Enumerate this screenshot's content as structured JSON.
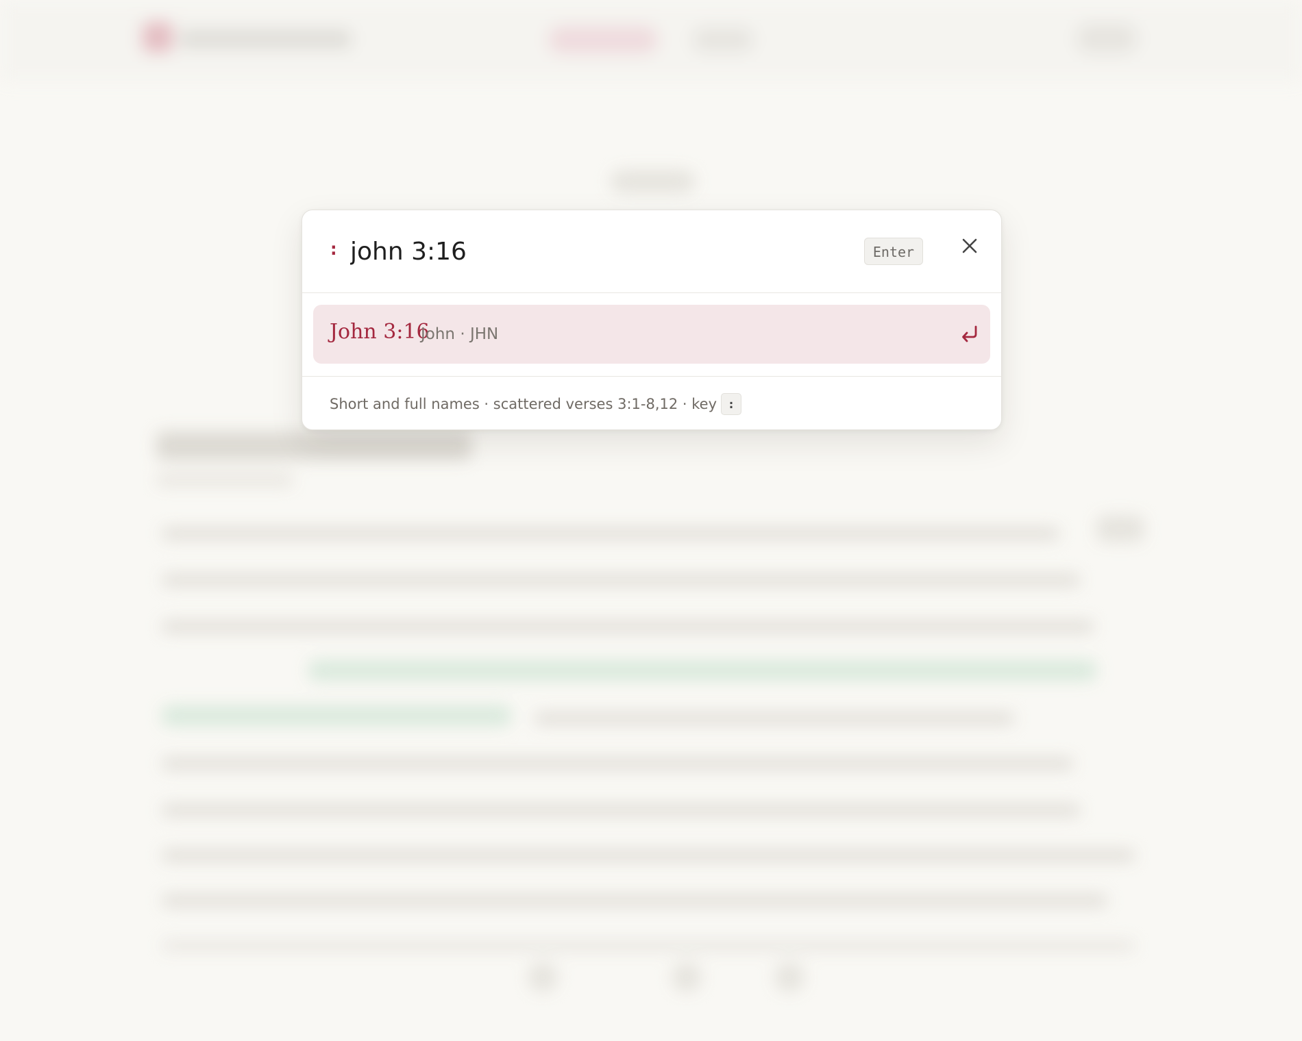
{
  "search": {
    "prefix": ":",
    "query": "john 3:16",
    "enter_hint": "Enter"
  },
  "result": {
    "reference": "John 3:16",
    "book_meta": "John · JHN"
  },
  "hint": {
    "text": "Short and full names · scattered verses 3:1-8,12 · key",
    "key": ":"
  },
  "icons": {
    "close": "close-icon",
    "return": "return-icon"
  },
  "colors": {
    "accent": "#a4283f",
    "result_bg": "#f4e6e8",
    "page_bg": "#f9f8f4"
  }
}
